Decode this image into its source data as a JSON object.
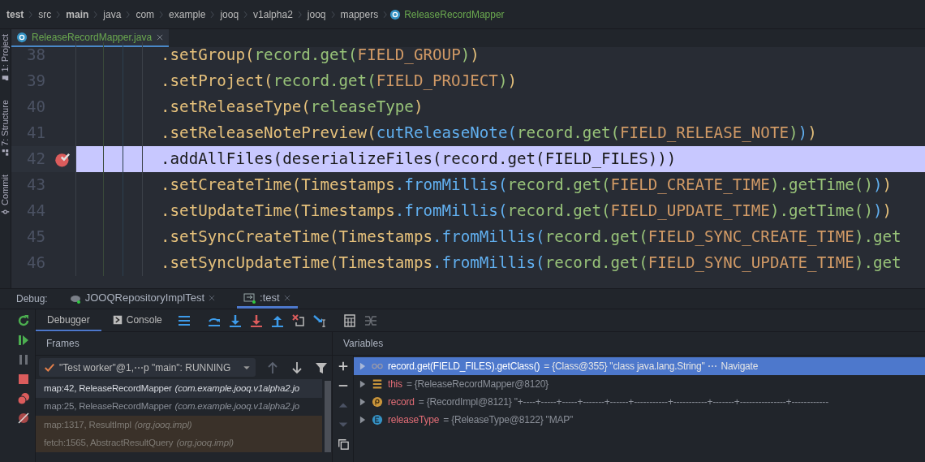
{
  "breadcrumbs": [
    {
      "text": "test",
      "kind": "bold"
    },
    {
      "text": "src",
      "kind": "plain"
    },
    {
      "text": "main",
      "kind": "bold"
    },
    {
      "text": "java",
      "kind": "plain"
    },
    {
      "text": "com",
      "kind": "plain"
    },
    {
      "text": "example",
      "kind": "plain"
    },
    {
      "text": "jooq",
      "kind": "plain"
    },
    {
      "text": "v1alpha2",
      "kind": "plain"
    },
    {
      "text": "jooq",
      "kind": "plain"
    },
    {
      "text": "mappers",
      "kind": "plain"
    },
    {
      "text": "ReleaseRecordMapper",
      "kind": "class"
    }
  ],
  "tool_strip": [
    {
      "label": "1: Project",
      "kind": "folder"
    },
    {
      "label": "7: Structure",
      "kind": "structure"
    },
    {
      "label": "Commit",
      "kind": "commit"
    }
  ],
  "editor_tabs": [
    {
      "label": "ReleaseRecordMapper.java",
      "selected": true
    }
  ],
  "code_lines": [
    {
      "number": "38",
      "breakpoint": false,
      "current": false,
      "tokens": [
        {
          "kind": "call",
          "text": ".setGroup("
        },
        {
          "kind": "arg",
          "text": "record.get("
        },
        {
          "kind": "const",
          "text": "FIELD_GROUP"
        },
        {
          "kind": "arg",
          "text": ")"
        },
        {
          "kind": "call",
          "text": ")"
        }
      ]
    },
    {
      "number": "39",
      "breakpoint": false,
      "current": false,
      "tokens": [
        {
          "kind": "call",
          "text": ".setProject("
        },
        {
          "kind": "arg",
          "text": "record.get("
        },
        {
          "kind": "const",
          "text": "FIELD_PROJECT"
        },
        {
          "kind": "arg",
          "text": ")"
        },
        {
          "kind": "call",
          "text": ")"
        }
      ]
    },
    {
      "number": "40",
      "breakpoint": false,
      "current": false,
      "tokens": [
        {
          "kind": "call",
          "text": ".setReleaseType("
        },
        {
          "kind": "arg",
          "text": "releaseType"
        },
        {
          "kind": "call",
          "text": ")"
        }
      ]
    },
    {
      "number": "41",
      "breakpoint": false,
      "current": false,
      "tokens": [
        {
          "kind": "call",
          "text": ".setReleaseNotePreview("
        },
        {
          "kind": "static",
          "text": "cutReleaseNote("
        },
        {
          "kind": "arg",
          "text": "record.get("
        },
        {
          "kind": "const",
          "text": "FIELD_RELEASE_NOTE"
        },
        {
          "kind": "arg",
          "text": ")"
        },
        {
          "kind": "static",
          "text": ")"
        },
        {
          "kind": "call",
          "text": ")"
        }
      ]
    },
    {
      "number": "42",
      "breakpoint": true,
      "current": true,
      "tokens": [
        {
          "kind": "call",
          "text": ".addAllFiles("
        },
        {
          "kind": "static",
          "text": "deserializeFiles("
        },
        {
          "kind": "arg",
          "text": "record.get("
        },
        {
          "kind": "const",
          "text": "FIELD_FILES"
        },
        {
          "kind": "arg",
          "text": ")"
        },
        {
          "kind": "static",
          "text": ")"
        },
        {
          "kind": "call",
          "text": ")"
        }
      ]
    },
    {
      "number": "43",
      "breakpoint": false,
      "current": false,
      "tokens": [
        {
          "kind": "call",
          "text": ".setCreateTime("
        },
        {
          "kind": "type",
          "text": "Timestamps"
        },
        {
          "kind": "static",
          "text": ".fromMillis("
        },
        {
          "kind": "arg",
          "text": "record.get("
        },
        {
          "kind": "const",
          "text": "FIELD_CREATE_TIME"
        },
        {
          "kind": "arg",
          "text": ").getTime()"
        },
        {
          "kind": "static",
          "text": ")"
        },
        {
          "kind": "call",
          "text": ")"
        }
      ]
    },
    {
      "number": "44",
      "breakpoint": false,
      "current": false,
      "tokens": [
        {
          "kind": "call",
          "text": ".setUpdateTime("
        },
        {
          "kind": "type",
          "text": "Timestamps"
        },
        {
          "kind": "static",
          "text": ".fromMillis("
        },
        {
          "kind": "arg",
          "text": "record.get("
        },
        {
          "kind": "const",
          "text": "FIELD_UPDATE_TIME"
        },
        {
          "kind": "arg",
          "text": ").getTime()"
        },
        {
          "kind": "static",
          "text": ")"
        },
        {
          "kind": "call",
          "text": ")"
        }
      ]
    },
    {
      "number": "45",
      "breakpoint": false,
      "current": false,
      "tokens": [
        {
          "kind": "call",
          "text": ".setSyncCreateTime("
        },
        {
          "kind": "type",
          "text": "Timestamps"
        },
        {
          "kind": "static",
          "text": ".fromMillis("
        },
        {
          "kind": "arg",
          "text": "record.get("
        },
        {
          "kind": "const",
          "text": "FIELD_SYNC_CREATE_TIME"
        },
        {
          "kind": "arg",
          "text": ").get"
        }
      ]
    },
    {
      "number": "46",
      "breakpoint": false,
      "current": false,
      "tokens": [
        {
          "kind": "call",
          "text": ".setSyncUpdateTime("
        },
        {
          "kind": "type",
          "text": "Timestamps"
        },
        {
          "kind": "static",
          "text": ".fromMillis("
        },
        {
          "kind": "arg",
          "text": "record.get("
        },
        {
          "kind": "const",
          "text": "FIELD_SYNC_UPDATE_TIME"
        },
        {
          "kind": "arg",
          "text": ").get"
        }
      ]
    }
  ],
  "debug": {
    "title": "Debug:",
    "tabs": [
      {
        "label": "JOOQRepositoryImplTest",
        "kind": "gradle",
        "selected": false
      },
      {
        "label": ":test",
        "kind": "run",
        "selected": true
      }
    ],
    "inner_tabs": [
      {
        "label": "Debugger",
        "kind": "debugger",
        "selected": true
      },
      {
        "label": "Console",
        "kind": "console",
        "selected": false
      }
    ],
    "frames": {
      "title": "Frames",
      "thread": "\"Test worker\"@1,⋯p \"main\": RUNNING",
      "items": [
        {
          "method": "map:42, ReleaseRecordMapper",
          "package": "(com.example.jooq.v1alpha2.jo",
          "selected": true,
          "library": false
        },
        {
          "method": "map:25, ReleaseRecordMapper",
          "package": "(com.example.jooq.v1alpha2.jo",
          "selected": false,
          "library": false
        },
        {
          "method": "map:1317, ResultImpl",
          "package": "(org.jooq.impl)",
          "selected": false,
          "library": true
        },
        {
          "method": "fetch:1565, AbstractResultQuery",
          "package": "(org.jooq.impl)",
          "selected": false,
          "library": true
        }
      ]
    },
    "variables": {
      "title": "Variables",
      "items": [
        {
          "kind": "watch",
          "name": "record.get(FIELD_FILES).getClass()",
          "value": "= {Class@355} \"class java.lang.String\" ⋯",
          "link": "Navigate",
          "selected": true
        },
        {
          "kind": "field",
          "name": "this",
          "value": "= {ReleaseRecordMapper@8120}",
          "selected": false
        },
        {
          "kind": "param",
          "name": "record",
          "value": "= {RecordImpl@8121} \"+----+-----+-----+-------+------+-----------+-----------+-------+---------------+------------",
          "selected": false
        },
        {
          "kind": "enum",
          "name": "releaseType",
          "value": "= {ReleaseType@8122} \"MAP\"",
          "selected": false
        }
      ]
    }
  }
}
